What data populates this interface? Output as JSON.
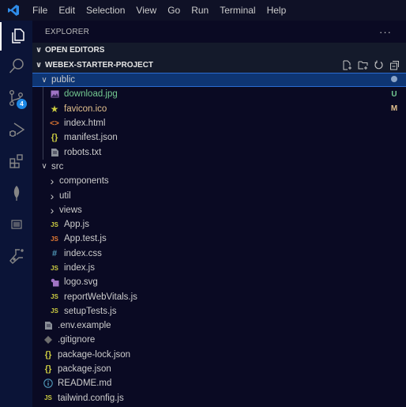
{
  "menu": [
    "File",
    "Edit",
    "Selection",
    "View",
    "Go",
    "Run",
    "Terminal",
    "Help"
  ],
  "activity_bar": {
    "items": [
      {
        "name": "explorer-icon",
        "active": true
      },
      {
        "name": "search-icon"
      },
      {
        "name": "source-control-icon",
        "badge": "4"
      },
      {
        "name": "run-debug-icon"
      },
      {
        "name": "extensions-icon"
      },
      {
        "name": "mongodb-leaf-icon"
      },
      {
        "name": "panel-icon"
      },
      {
        "name": "testing-flask-icon"
      }
    ]
  },
  "sidebar": {
    "title": "EXPLORER",
    "more": "···",
    "sections": {
      "open_editors": "OPEN EDITORS",
      "project": "WEBEX-STARTER-PROJECT"
    }
  },
  "tree": [
    {
      "label": "public",
      "type": "folder",
      "open": true,
      "depth": 0,
      "selected": true,
      "deco": "dot"
    },
    {
      "label": "download.jpg",
      "type": "image",
      "depth": 1,
      "color": "#73c991",
      "deco": "U",
      "deco_color": "#73c991"
    },
    {
      "label": "favicon.ico",
      "type": "star",
      "depth": 1,
      "color": "#e2c08d",
      "deco": "M",
      "deco_color": "#e2c08d"
    },
    {
      "label": "index.html",
      "type": "html",
      "depth": 1
    },
    {
      "label": "manifest.json",
      "type": "json",
      "depth": 1
    },
    {
      "label": "robots.txt",
      "type": "text",
      "depth": 1
    },
    {
      "label": "src",
      "type": "folder",
      "open": true,
      "depth": 0
    },
    {
      "label": "components",
      "type": "folder",
      "open": false,
      "depth": 1
    },
    {
      "label": "util",
      "type": "folder",
      "open": false,
      "depth": 1
    },
    {
      "label": "views",
      "type": "folder",
      "open": false,
      "depth": 1
    },
    {
      "label": "App.js",
      "type": "js",
      "depth": 1
    },
    {
      "label": "App.test.js",
      "type": "jstest",
      "depth": 1
    },
    {
      "label": "index.css",
      "type": "css",
      "depth": 1
    },
    {
      "label": "index.js",
      "type": "js",
      "depth": 1
    },
    {
      "label": "logo.svg",
      "type": "svg",
      "depth": 1
    },
    {
      "label": "reportWebVitals.js",
      "type": "js",
      "depth": 1
    },
    {
      "label": "setupTests.js",
      "type": "js",
      "depth": 1
    },
    {
      "label": ".env.example",
      "type": "text",
      "depth": 0
    },
    {
      "label": ".gitignore",
      "type": "git",
      "depth": 0
    },
    {
      "label": "package-lock.json",
      "type": "json",
      "depth": 0
    },
    {
      "label": "package.json",
      "type": "json",
      "depth": 0
    },
    {
      "label": "README.md",
      "type": "info",
      "depth": 0
    },
    {
      "label": "tailwind.config.js",
      "type": "js",
      "depth": 0
    }
  ]
}
